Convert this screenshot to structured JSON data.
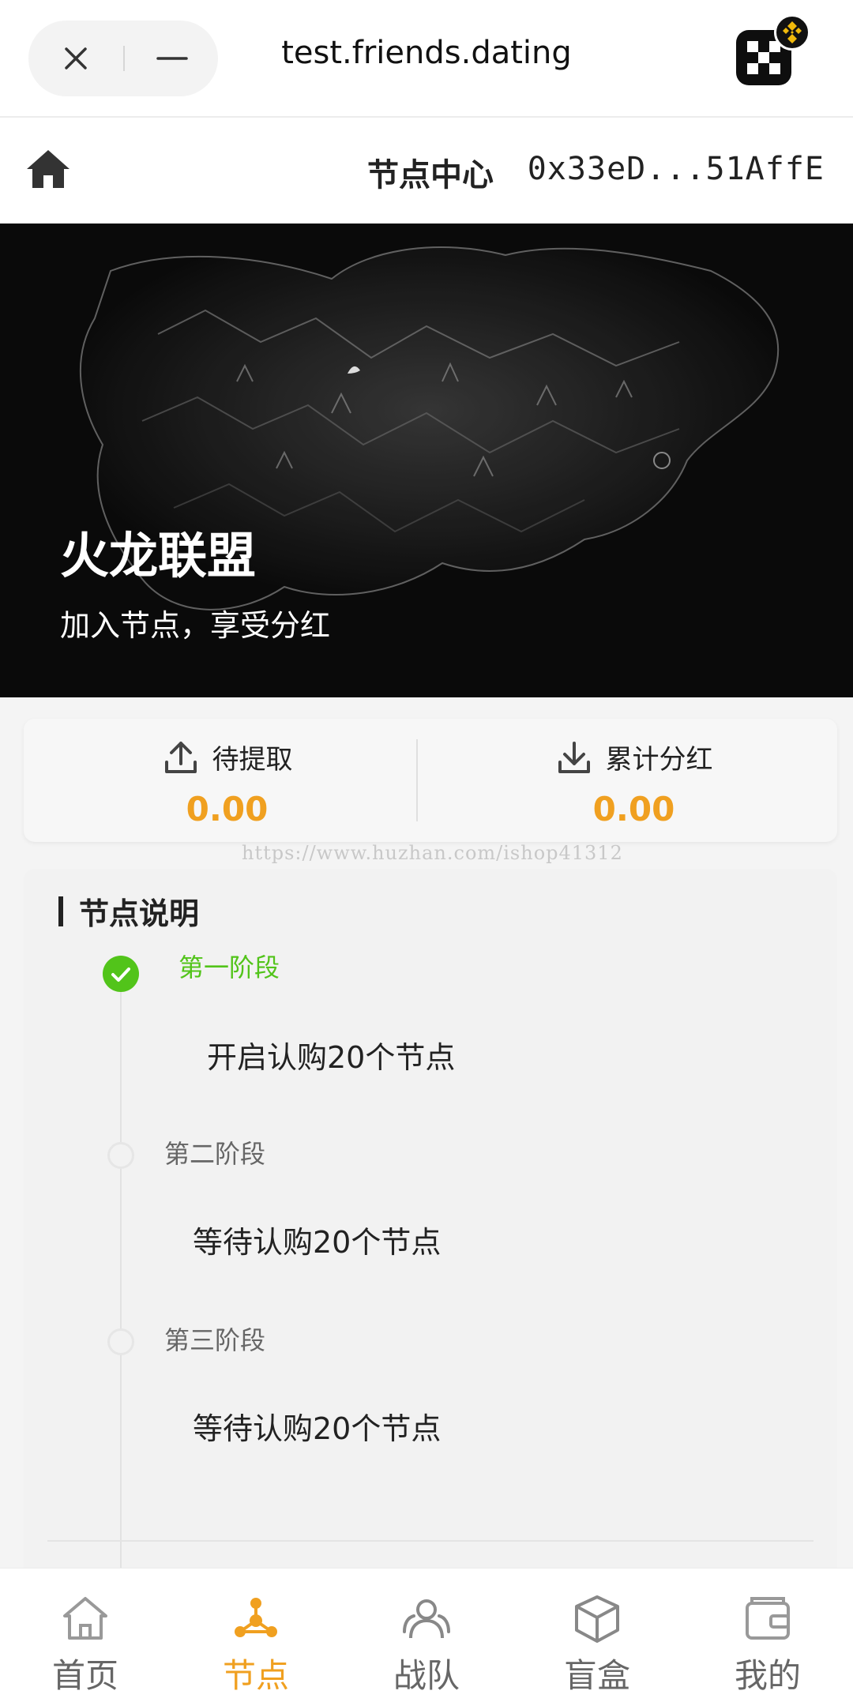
{
  "browser": {
    "url": "test.friends.dating",
    "close_icon": "close-icon",
    "minimize_icon": "minus-icon"
  },
  "header": {
    "title": "节点中心",
    "wallet_address": "0x33eD...51AffE",
    "home_icon": "home-icon"
  },
  "hero": {
    "title": "火龙联盟",
    "subtitle": "加入节点，享受分红"
  },
  "stats": {
    "pending": {
      "label": "待提取",
      "value": "0.00",
      "icon": "upload-icon"
    },
    "total": {
      "label": "累计分红",
      "value": "0.00",
      "icon": "download-icon"
    }
  },
  "watermark": "https://www.huzhan.com/ishop41312",
  "node_info": {
    "title": "节点说明",
    "steps": [
      {
        "name": "第一阶段",
        "desc": "开启认购20个节点",
        "done": true
      },
      {
        "name": "第二阶段",
        "desc": "等待认购20个节点",
        "done": false
      },
      {
        "name": "第三阶段",
        "desc": "等待认购20个节点",
        "done": false
      }
    ]
  },
  "tabbar": {
    "items": [
      {
        "label": "首页",
        "icon": "home-outline-icon",
        "active": false
      },
      {
        "label": "节点",
        "icon": "node-icon",
        "active": true
      },
      {
        "label": "战队",
        "icon": "team-icon",
        "active": false
      },
      {
        "label": "盲盒",
        "icon": "box-icon",
        "active": false
      },
      {
        "label": "我的",
        "icon": "wallet-icon",
        "active": false
      }
    ]
  },
  "colors": {
    "accent": "#f0a020",
    "success": "#52c41a"
  }
}
